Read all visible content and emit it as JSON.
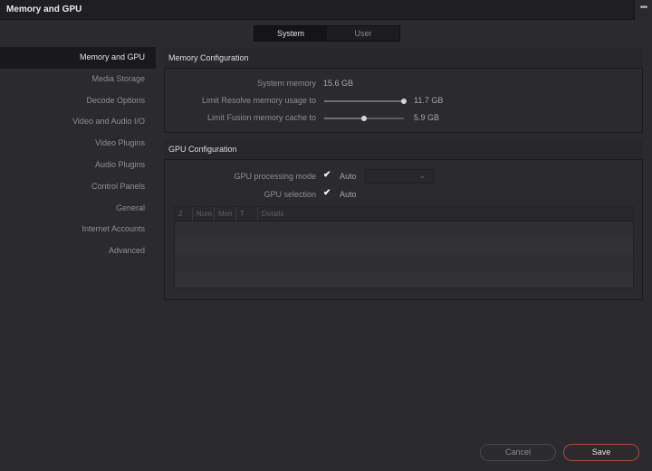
{
  "window": {
    "title": "Memory and GPU",
    "menu_icon": "more-dots-icon",
    "menu_glyph": "•••"
  },
  "tabs": [
    {
      "label": "System",
      "active": true
    },
    {
      "label": "User",
      "active": false
    }
  ],
  "sidebar": {
    "items": [
      {
        "label": "Memory and GPU",
        "active": true
      },
      {
        "label": "Media Storage"
      },
      {
        "label": "Decode Options"
      },
      {
        "label": "Video and Audio I/O"
      },
      {
        "label": "Video Plugins"
      },
      {
        "label": "Audio Plugins"
      },
      {
        "label": "Control Panels"
      },
      {
        "label": "General"
      },
      {
        "label": "Internet Accounts"
      },
      {
        "label": "Advanced"
      }
    ]
  },
  "memory": {
    "heading": "Memory Configuration",
    "system_memory_label": "System memory",
    "system_memory_value": "15.6 GB",
    "limit_resolve_label": "Limit Resolve memory usage to",
    "limit_resolve_value": "11.7 GB",
    "limit_resolve_fraction": 1.0,
    "limit_fusion_label": "Limit Fusion memory cache to",
    "limit_fusion_value": "5.9 GB",
    "limit_fusion_fraction": 0.5
  },
  "gpu": {
    "heading": "GPU Configuration",
    "processing_mode_label": "GPU processing mode",
    "processing_mode_checked": true,
    "processing_mode_auto": "Auto",
    "selection_label": "GPU selection",
    "selection_checked": true,
    "selection_auto": "Auto",
    "table_columns": [
      "2",
      "Num",
      "Mon",
      "T",
      "Details"
    ]
  },
  "footer": {
    "cancel_label": "Cancel",
    "save_label": "Save"
  },
  "colors": {
    "accent_save": "#b0473e",
    "background": "#2b2a2f"
  }
}
